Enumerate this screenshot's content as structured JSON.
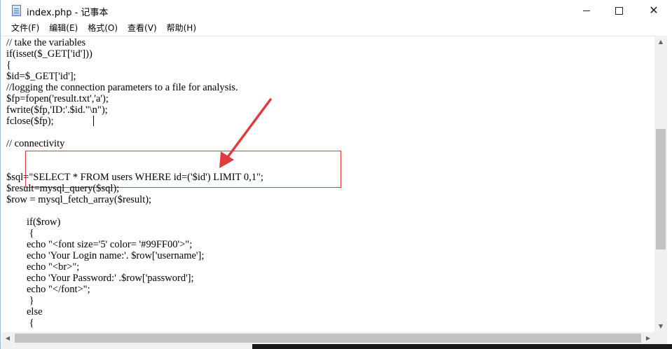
{
  "window": {
    "title": "index.php - 记事本"
  },
  "title_controls": {
    "minimize": "—",
    "maximize": "☐",
    "close": "✕"
  },
  "menu": {
    "items": [
      "文件(F)",
      "编辑(E)",
      "格式(O)",
      "查看(V)",
      "帮助(H)"
    ]
  },
  "code_lines": [
    "// take the variables",
    "if(isset($_GET['id']))",
    "{",
    "$id=$_GET['id'];",
    "//logging the connection parameters to a file for analysis.",
    "$fp=fopen('result.txt','a');",
    "fwrite($fp,'ID:'.$id.\"\\n\");",
    "fclose($fp);",
    "",
    "// connectivity",
    "",
    "",
    "$sql=\"SELECT * FROM users WHERE id=('$id') LIMIT 0,1\";",
    "$result=mysql_query($sql);",
    "$row = mysql_fetch_array($result);",
    "",
    "        if($row)",
    "         {",
    "        echo \"<font size='5' color= '#99FF00'>\";",
    "        echo 'Your Login name:'. $row['username'];",
    "        echo \"<br>\";",
    "        echo 'Your Password:' .$row['password'];",
    "        echo \"</font>\";",
    "         }",
    "        else",
    "         {"
  ],
  "colors": {
    "annotation_red": "#e23a3a",
    "scroll_thumb": "#c2c2c2"
  },
  "icons": {
    "app": "notepad-icon",
    "scroll_up": "scroll-up-arrow-icon",
    "scroll_down": "scroll-down-arrow-icon",
    "scroll_left": "scroll-left-arrow-icon",
    "scroll_right": "scroll-right-arrow-icon"
  }
}
